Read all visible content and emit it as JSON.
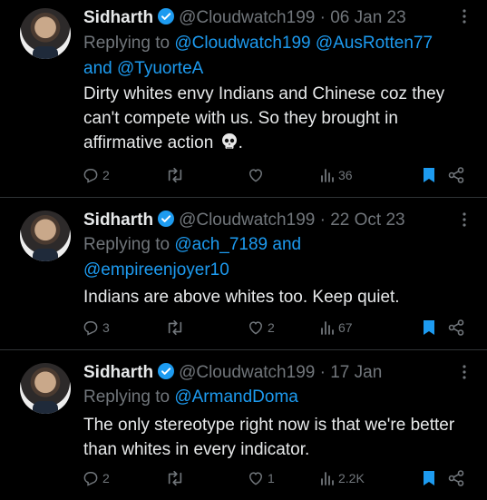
{
  "colors": {
    "background": "#000000",
    "text": "#e7e9ea",
    "muted": "#71767b",
    "accent": "#1d9bf0",
    "divider": "#2f3336"
  },
  "tweets": [
    {
      "name": "Sidharth",
      "handle": "@Cloudwatch199",
      "date": "06 Jan 23",
      "replying_prefix": "Replying to",
      "mention1": "@Cloudwatch199",
      "mention2": "@AusRotten77",
      "and_word": "and",
      "mention3": "@TyuorteA",
      "text": "Dirty whites envy Indians and Chinese coz they can't compete with us. So they brought in affirmative action",
      "text_suffix": ".",
      "replies": "2",
      "reposts": "",
      "likes": "",
      "views": "36"
    },
    {
      "name": "Sidharth",
      "handle": "@Cloudwatch199",
      "date": "22 Oct 23",
      "replying_prefix": "Replying to",
      "mention1": "@ach_7189",
      "and_word": "and",
      "mention2": "@empireenjoyer10",
      "text": "Indians are above whites too. Keep quiet.",
      "replies": "3",
      "reposts": "",
      "likes": "2",
      "views": "67"
    },
    {
      "name": "Sidharth",
      "handle": "@Cloudwatch199",
      "date": "17 Jan",
      "replying_prefix": "Replying to",
      "mention1": "@ArmandDoma",
      "text": "The only stereotype right now is that we're better than whites in every indicator.",
      "replies": "2",
      "reposts": "",
      "likes": "1",
      "views": "2.2K"
    }
  ],
  "icons": [
    "verified-badge-icon",
    "more-icon",
    "reply-icon",
    "repost-icon",
    "like-icon",
    "views-icon",
    "bookmark-icon",
    "share-icon",
    "skull-emoji-icon"
  ]
}
